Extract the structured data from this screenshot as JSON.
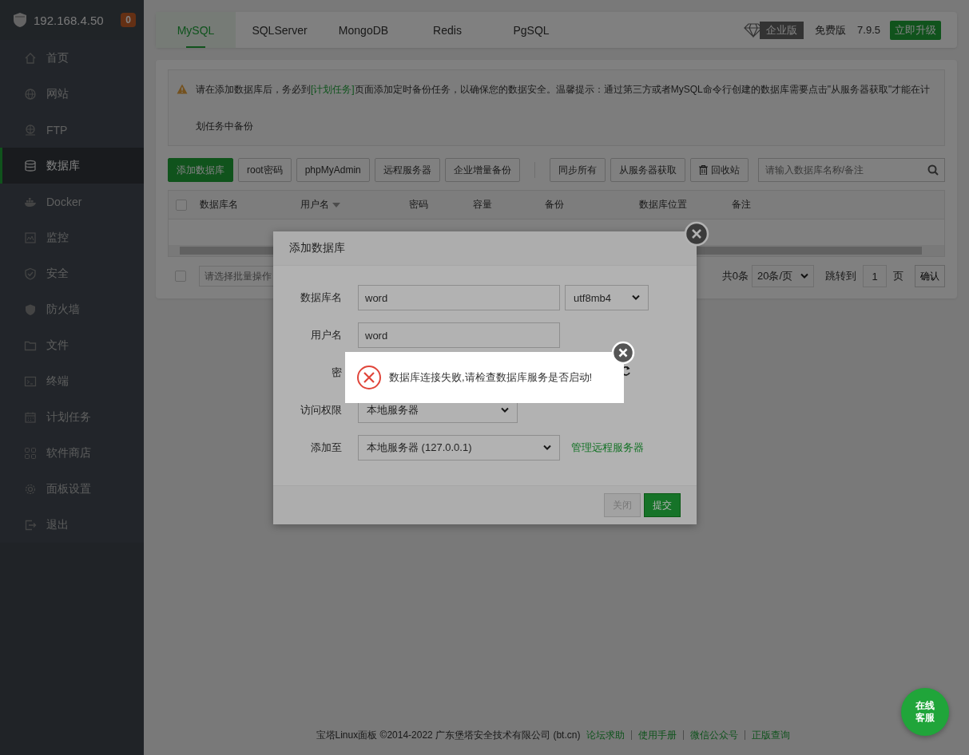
{
  "sidebar": {
    "host": "192.168.4.50",
    "badge": "0",
    "items": [
      {
        "label": "首页",
        "selected": false
      },
      {
        "label": "网站",
        "selected": false
      },
      {
        "label": "FTP",
        "selected": false
      },
      {
        "label": "数据库",
        "selected": true
      },
      {
        "label": "Docker",
        "selected": false
      },
      {
        "label": "监控",
        "selected": false
      },
      {
        "label": "安全",
        "selected": false
      },
      {
        "label": "防火墙",
        "selected": false
      },
      {
        "label": "文件",
        "selected": false
      },
      {
        "label": "终端",
        "selected": false
      },
      {
        "label": "计划任务",
        "selected": false
      },
      {
        "label": "软件商店",
        "selected": false
      },
      {
        "label": "面板设置",
        "selected": false
      },
      {
        "label": "退出",
        "selected": false
      }
    ]
  },
  "db_tabs": [
    {
      "label": "MySQL",
      "selected": true
    },
    {
      "label": "SQLServer",
      "selected": false
    },
    {
      "label": "MongoDB",
      "selected": false
    },
    {
      "label": "Redis",
      "selected": false
    },
    {
      "label": "PgSQL",
      "selected": false
    }
  ],
  "edition": {
    "enterprise": "企业版",
    "free": "免费版",
    "version": "7.9.5",
    "upgrade": "立即升级"
  },
  "notice": {
    "before": "请在添加数据库后，务必到",
    "link": "[计划任务]",
    "after": "页面添加定时备份任务，以确保您的数据安全。温馨提示：通过第三方或者MySQL命令行创建的数据库需要点击\"从服务器获取\"才能在计划任务中备份"
  },
  "toolbar": {
    "left_buttons": [
      {
        "label": "添加数据库",
        "kind": "primary"
      },
      {
        "label": "root密码",
        "kind": "plain"
      },
      {
        "label": "phpMyAdmin",
        "kind": "plain"
      },
      {
        "label": "远程服务器",
        "kind": "plain"
      },
      {
        "label": "企业增量备份",
        "kind": "plain"
      }
    ],
    "right_buttons": [
      {
        "label": "同步所有",
        "kind": "plain"
      },
      {
        "label": "从服务器获取",
        "kind": "plain"
      },
      {
        "label": "回收站",
        "kind": "trash"
      }
    ],
    "search": {
      "placeholder": "请输入数据库名称/备注"
    }
  },
  "table": {
    "select_all": {
      "checked": false
    },
    "columns": [
      {
        "label": "数据库名",
        "sorted": false
      },
      {
        "label": "用户名",
        "sorted": true
      },
      {
        "label": "密码",
        "sorted": false
      },
      {
        "label": "容量",
        "sorted": false
      },
      {
        "label": "备份",
        "sorted": false
      },
      {
        "label": "数据库位置",
        "sorted": false
      },
      {
        "label": "备注",
        "sorted": false
      }
    ]
  },
  "pagination": {
    "select_all": {
      "checked": false
    },
    "batch_placeholder": "请选择批量操作",
    "total": "共0条",
    "page_size": "20条/页",
    "jump_label": "跳转到",
    "page": "1",
    "page_unit": "页",
    "confirm": "确认"
  },
  "modal": {
    "title": "添加数据库",
    "fields": [
      {
        "label": "数据库名",
        "kind": "input",
        "value": "word",
        "extra": "utf8mb4"
      },
      {
        "label": "用户名",
        "kind": "input",
        "value": "word"
      },
      {
        "label": "密",
        "kind": "hidden"
      },
      {
        "label": "访问权限",
        "kind": "select",
        "value": "本地服务器"
      },
      {
        "label": "添加至",
        "kind": "select",
        "value": "本地服务器 (127.0.0.1)",
        "link": "管理远程服务器"
      }
    ],
    "buttons": [
      {
        "label": "关闭",
        "kind": "secondary"
      },
      {
        "label": "提交",
        "kind": "primary"
      }
    ]
  },
  "toast": {
    "message": "数据库连接失败,请检查数据库服务是否启动!"
  },
  "footer": {
    "copyright": "宝塔Linux面板 ©2014-2022 广东堡塔安全技术有限公司 (bt.cn)",
    "links": [
      "论坛求助",
      "使用手册",
      "微信公众号",
      "正版查询"
    ]
  },
  "chat": {
    "label": "在线客服"
  }
}
